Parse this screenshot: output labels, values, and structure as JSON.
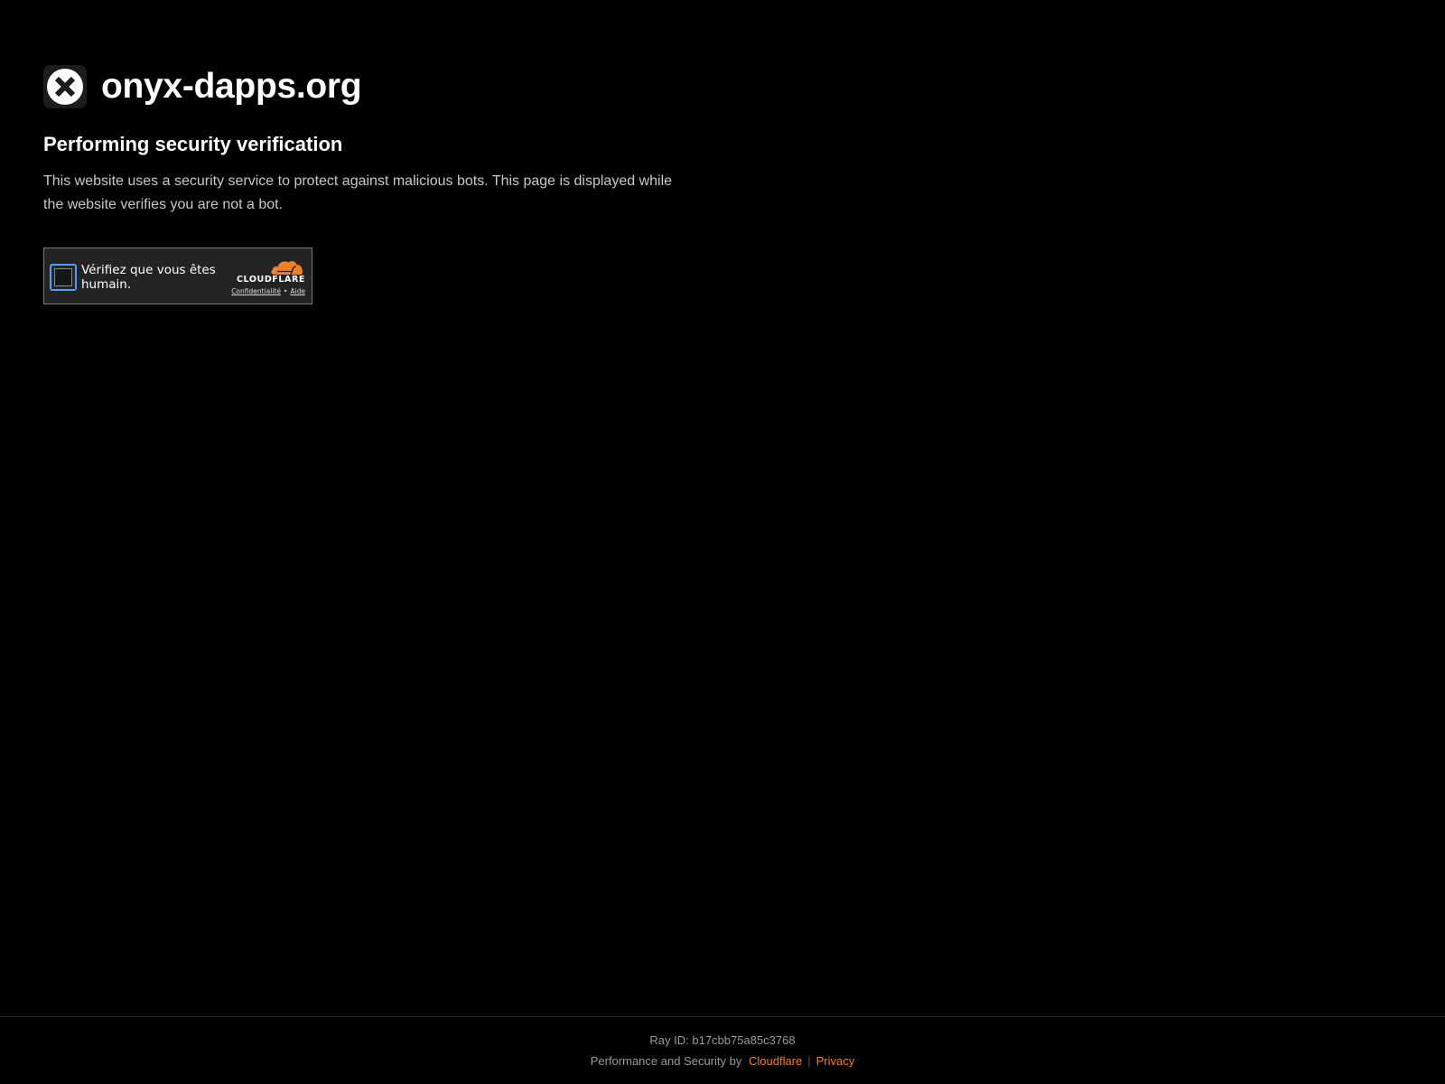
{
  "site": {
    "name": "onyx-dapps.org",
    "logo_icon": "x-circle-icon"
  },
  "main": {
    "heading": "Performing security verification",
    "description": "This website uses a security service to protect against malicious bots. This page is displayed while the website verifies you are not a bot."
  },
  "widget": {
    "checkbox_checked": false,
    "label": "Vérifiez que vous êtes humain.",
    "brand": "CLOUDFLARE",
    "privacy_link": "Confidentialité",
    "separator": "•",
    "help_link": "Aide"
  },
  "footer": {
    "ray_id": "Ray ID: b17cbb75a85c3768",
    "credits_prefix": "Performance and Security by",
    "cloudflare_link": "Cloudflare",
    "divider": "|",
    "privacy_link": "Privacy"
  },
  "colors": {
    "background": "#000000",
    "accent": "#f38020",
    "checkbox_focus": "#4f9bff"
  }
}
